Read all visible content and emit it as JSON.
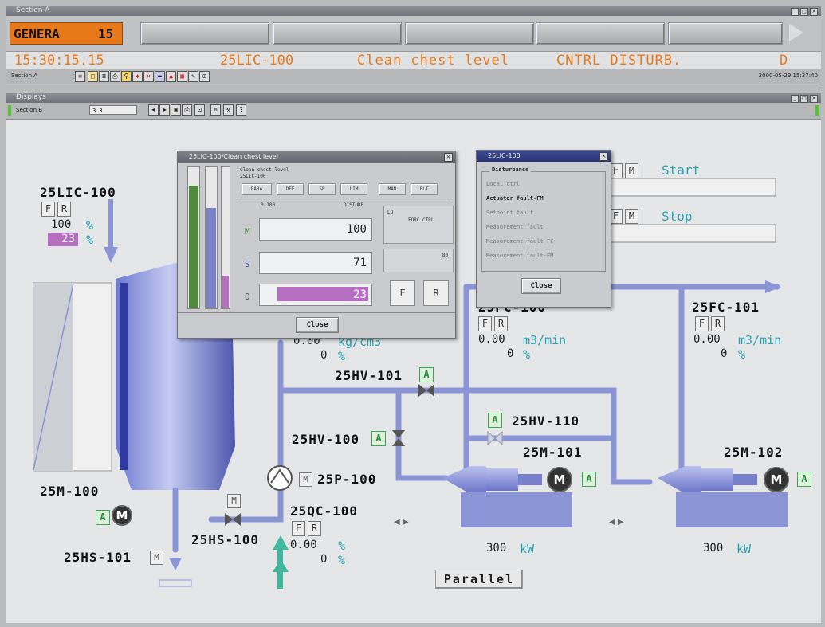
{
  "windows": {
    "section_a_title": "Section A",
    "display_title": "Displays"
  },
  "alarm_bar": {
    "status_badge": "GENERA",
    "status_count": "15",
    "time": "15:30:15.15",
    "tag": "25LIC-100",
    "description": "Clean chest level",
    "state": "CNTRL DISTURB.",
    "priority": "D"
  },
  "toolbar_a": {
    "section": "Section A",
    "datetime": "2000-05-29 15:37:40"
  },
  "toolbar_b": {
    "section": "Section B",
    "field": "3.3"
  },
  "process": {
    "lic100": {
      "tag": "25LIC-100",
      "f": "F",
      "r": "R",
      "value1": "100",
      "unit1": "%",
      "value2": "23",
      "unit2": "%"
    },
    "m100": {
      "tag": "25M-100",
      "a": "A",
      "motor": "M"
    },
    "hs101": {
      "tag": "25HS-101",
      "m": "M"
    },
    "hs100": {
      "tag": "25HS-100",
      "m": "M"
    },
    "p100": {
      "tag": "25P-100",
      "m": "M"
    },
    "qc100": {
      "tag": "25QC-100",
      "f": "F",
      "r": "R",
      "value1": "0.00",
      "unit1": "%",
      "value2": "0",
      "unit2": "%"
    },
    "flow_hidden": {
      "value1": "0.00",
      "unit1": "kg/cm3",
      "value2": "0",
      "unit2": "%"
    },
    "hv101": {
      "tag": "25HV-101",
      "a": "A"
    },
    "hv100": {
      "tag": "25HV-100",
      "a": "A"
    },
    "hv110": {
      "tag": "25HV-110",
      "a": "A"
    },
    "fc100": {
      "tag": "25FC-100",
      "f": "F",
      "r": "R",
      "value1": "0.00",
      "unit1": "m3/min",
      "value2": "0",
      "unit2": "%"
    },
    "fc101": {
      "tag": "25FC-101",
      "f": "F",
      "r": "R",
      "value1": "0.00",
      "unit1": "m3/min",
      "value2": "0",
      "unit2": "%"
    },
    "m101": {
      "tag": "25M-101",
      "motor": "M",
      "a": "A",
      "power": "300",
      "power_unit": "kW"
    },
    "m102": {
      "tag": "25M-102",
      "motor": "M",
      "a": "A",
      "power": "300",
      "power_unit": "kW"
    },
    "start": {
      "f": "F",
      "m": "M",
      "label": "Start"
    },
    "stop": {
      "f": "F",
      "m": "M",
      "label": "Stop"
    },
    "parallel": "Parallel"
  },
  "faceplate": {
    "title": "25LIC-100/Clean chest level",
    "desc1": "Clean chest level",
    "desc2": "25LIC-100",
    "buttons": [
      "PARA",
      "DEF",
      "SP",
      "LIM",
      "MAN",
      "FLT"
    ],
    "range": "0-100",
    "mode_text": "DISTURB",
    "m_label": "M",
    "m_value": "100",
    "s_label": "S",
    "s_value": "71",
    "o_label": "O",
    "o_value": "23",
    "side_text1": "LO",
    "side_text2": "FORC CTRL",
    "side_text3": "80",
    "f_btn": "F",
    "r_btn": "R",
    "close": "Close",
    "bar_m": 0.87,
    "bar_s": 0.71,
    "bar_o": 0.23
  },
  "disturbance": {
    "title": "25LIC-100",
    "header": "Disturbance",
    "items": [
      {
        "label": "Local ctrl",
        "active": false
      },
      {
        "label": "Actuator fault-FM",
        "active": true
      },
      {
        "label": "Setpoint fault",
        "active": false
      },
      {
        "label": "Measurement fault",
        "active": false
      },
      {
        "label": "Measurement fault-FC",
        "active": false
      },
      {
        "label": "Measurement fault-FM",
        "active": false
      }
    ],
    "close": "Close"
  },
  "colors": {
    "alarm_orange": "#e8791a",
    "process_cyan": "#2aa3b0",
    "pipe_blue": "#8b95d6",
    "bar_green": "#4f8a3a",
    "bar_purple": "#b56fc0"
  }
}
